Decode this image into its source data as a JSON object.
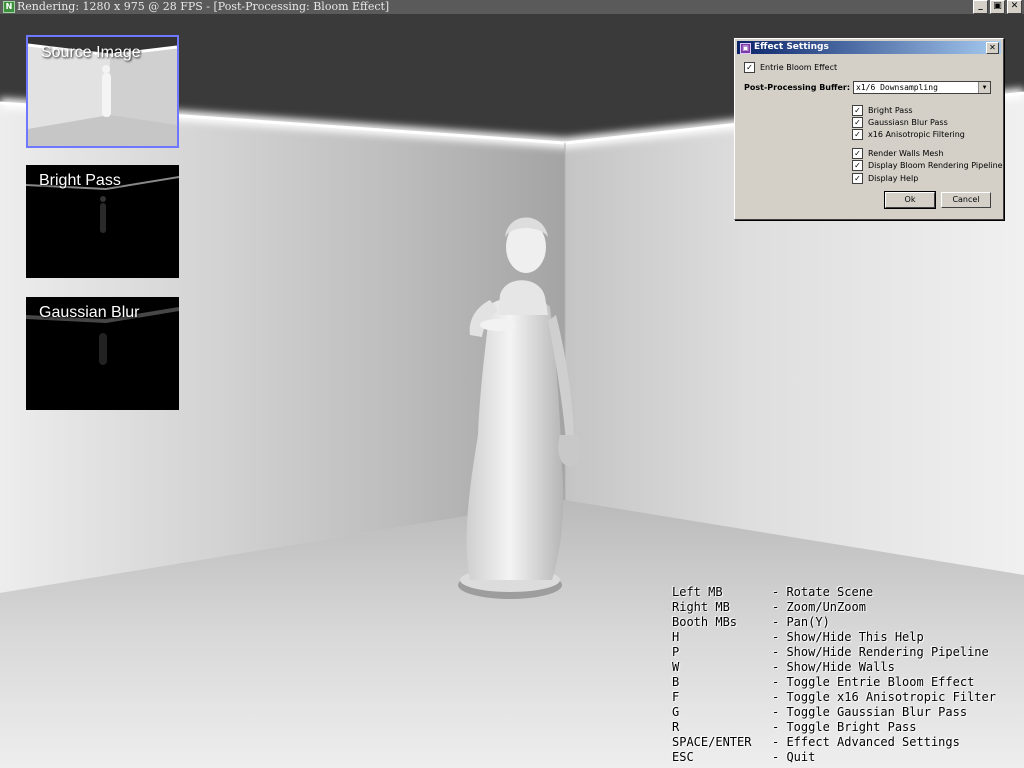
{
  "window": {
    "title": "Rendering: 1280 x 975 @ 28 FPS - [Post-Processing: Bloom Effect]",
    "app_icon": "N",
    "minimize_glyph": "_",
    "maximize_glyph": "▣",
    "close_glyph": "✕"
  },
  "pipeline": {
    "source_label": "Source Image",
    "bright_label": "Bright Pass",
    "blur_label": "Gaussian Blur"
  },
  "dialog": {
    "title": "Effect Settings",
    "close_glyph": "✕",
    "enable_label": "Entrie Bloom Effect",
    "enable_checked": true,
    "buffer_label": "Post-Processing Buffer:",
    "buffer_value": "x1/6 Downsampling",
    "options": [
      {
        "label": "Bright Pass",
        "checked": true
      },
      {
        "label": "Gaussiasn Blur Pass",
        "checked": true
      },
      {
        "label": "x16 Anisotropic Filtering",
        "checked": true
      },
      {
        "label": "Render Walls Mesh",
        "checked": true
      },
      {
        "label": "Display Bloom Rendering Pipeline",
        "checked": true
      },
      {
        "label": "Display Help",
        "checked": true
      }
    ],
    "ok_label": "Ok",
    "cancel_label": "Cancel",
    "check_glyph": "✓"
  },
  "help": [
    {
      "key": "Left MB",
      "desc": "- Rotate Scene"
    },
    {
      "key": "Right MB",
      "desc": "- Zoom/UnZoom"
    },
    {
      "key": "Booth MBs",
      "desc": "- Pan(Y)"
    },
    {
      "key": "H",
      "desc": "- Show/Hide This Help"
    },
    {
      "key": "P",
      "desc": "- Show/Hide Rendering Pipeline"
    },
    {
      "key": "W",
      "desc": "- Show/Hide Walls"
    },
    {
      "key": "B",
      "desc": "- Toggle Entrie Bloom Effect"
    },
    {
      "key": "F",
      "desc": "- Toggle x16 Anisotropic Filter"
    },
    {
      "key": "G",
      "desc": "- Toggle Gaussian Blur Pass"
    },
    {
      "key": "R",
      "desc": "- Toggle Bright Pass"
    },
    {
      "key": "SPACE/ENTER",
      "desc": "- Effect Advanced Settings"
    },
    {
      "key": "ESC",
      "desc": "- Quit"
    }
  ]
}
